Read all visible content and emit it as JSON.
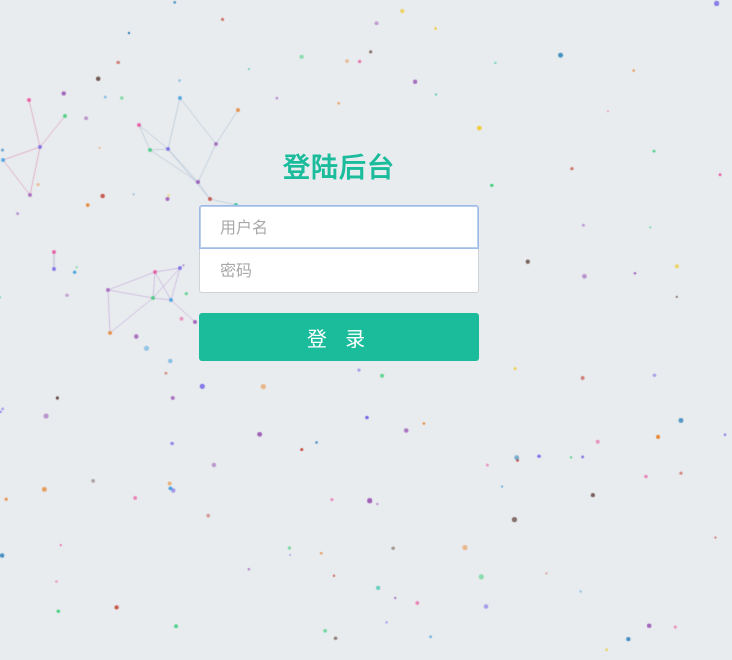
{
  "login": {
    "title": "登陆后台",
    "username_placeholder": "用户名",
    "password_placeholder": "密码",
    "submit_label": "登 录"
  },
  "colors": {
    "accent": "#1abc9c",
    "background": "#e9ecef"
  }
}
